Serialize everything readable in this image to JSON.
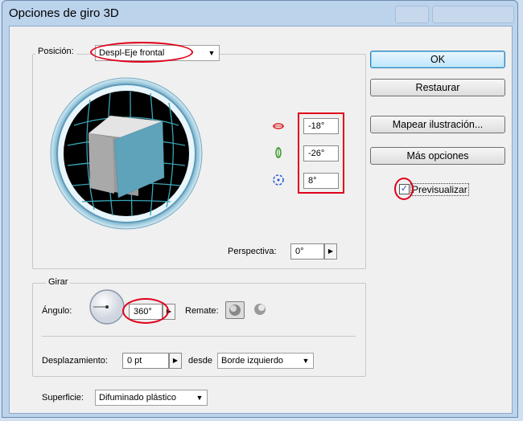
{
  "window": {
    "title": "Opciones de giro 3D"
  },
  "position": {
    "label": "Posición:",
    "label_underline": "n",
    "value": "Despl-Eje frontal",
    "rotations": [
      {
        "icon": "rotate-x-icon",
        "value": "-18°"
      },
      {
        "icon": "rotate-y-icon",
        "value": "-26°"
      },
      {
        "icon": "rotate-z-icon",
        "value": "8°"
      }
    ],
    "perspective_label": "Perspectiva:",
    "perspective_value": "0°"
  },
  "rotate": {
    "legend": "Girar",
    "angle_label": "Ángulo:",
    "angle_value": "360°",
    "cap_label": "Remate:",
    "offset_label": "Desplazamiento:",
    "offset_value": "0 pt",
    "from_label": "desde",
    "from_value": "Borde izquierdo"
  },
  "surface": {
    "label": "Superficie:",
    "value": "Difuminado plástico"
  },
  "buttons": {
    "ok": "OK",
    "reset": "Restaurar",
    "map": "Mapear ilustración...",
    "more": "Más opciones"
  },
  "preview": {
    "label": "Previsualizar",
    "checked": true
  },
  "colors": {
    "annotation": "#e0001b",
    "cube_face": "#5fa3bb",
    "accent": "#3c7fb1"
  }
}
